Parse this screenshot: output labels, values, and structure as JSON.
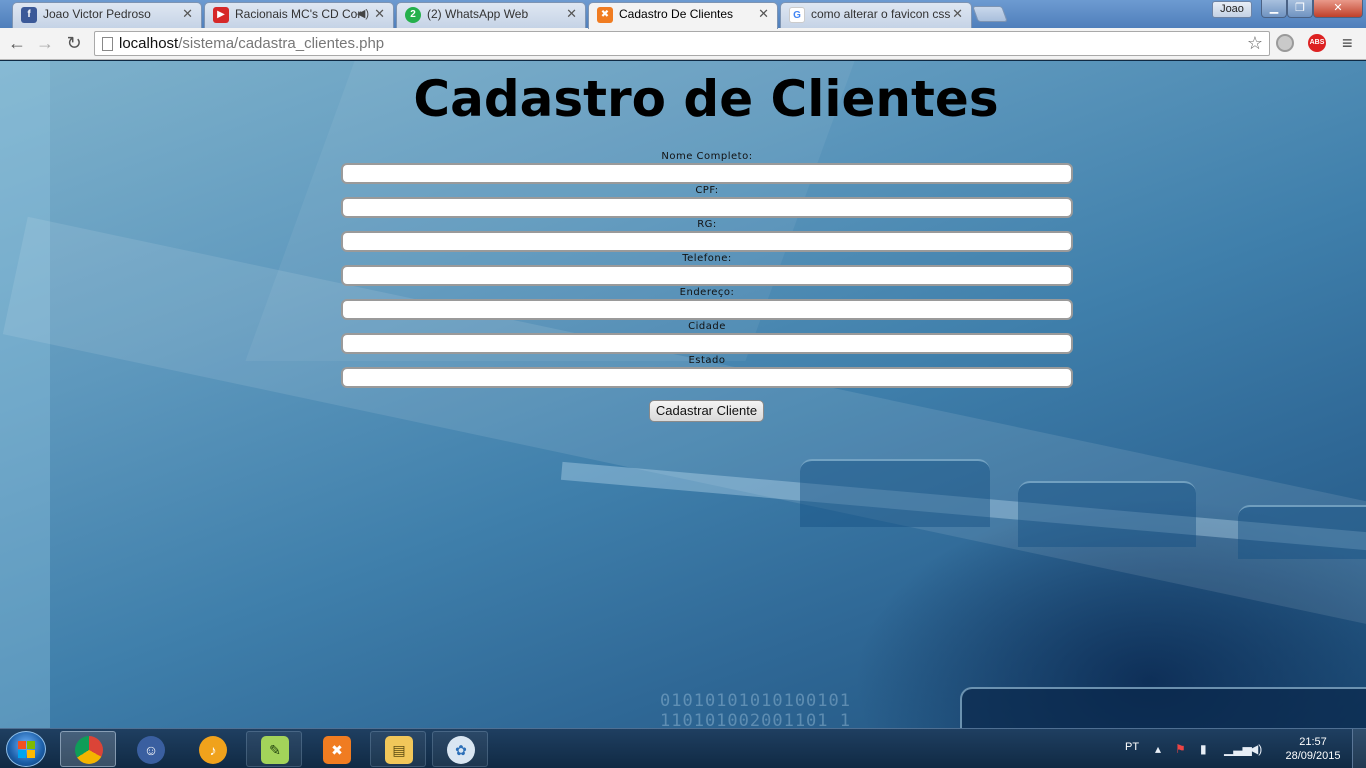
{
  "browser": {
    "tabs": [
      {
        "title": "Joao Victor Pedroso",
        "favicon": "facebook-icon",
        "color": "#3b5998",
        "active": false
      },
      {
        "title": "Racionais MC's CD Cor",
        "favicon": "youtube-icon",
        "color": "#d62828",
        "active": false,
        "audio": true
      },
      {
        "title": "(2) WhatsApp Web",
        "favicon": "whatsapp-icon",
        "badge": "2",
        "color": "#25b04c",
        "active": false
      },
      {
        "title": "Cadastro De Clientes",
        "favicon": "xampp-icon",
        "color": "#f07c21",
        "active": true
      },
      {
        "title": "como alterar o favicon css",
        "favicon": "google-icon",
        "color": "#4285f4",
        "active": false
      }
    ],
    "profile_name": "Joao",
    "url_host": "localhost",
    "url_path": "/sistema/cadastra_clientes.php",
    "extensions": [
      "opera-ext-icon",
      "adblock-icon"
    ],
    "adblock_label": "ABS"
  },
  "page": {
    "title": "Cadastro de Clientes",
    "fields": [
      {
        "label": "Nome Completo:",
        "value": ""
      },
      {
        "label": "CPF:",
        "value": ""
      },
      {
        "label": "RG:",
        "value": ""
      },
      {
        "label": "Telefone:",
        "value": ""
      },
      {
        "label": "Endereço:",
        "value": ""
      },
      {
        "label": "Cidade",
        "value": ""
      },
      {
        "label": "Estado",
        "value": ""
      }
    ],
    "submit_label": "Cadastrar Cliente",
    "background_text_line1": "01010101010100101",
    "background_text_line2": "110101002001101 1"
  },
  "taskbar": {
    "items": [
      {
        "name": "chrome",
        "icon": "chrome-icon",
        "pinned": true
      },
      {
        "name": "avatar-app",
        "icon": "character-icon"
      },
      {
        "name": "fl-studio",
        "icon": "fruity-loops-icon"
      },
      {
        "name": "notepad-plus",
        "icon": "notepad-plus-icon"
      },
      {
        "name": "xampp",
        "icon": "xampp-icon"
      },
      {
        "name": "explorer",
        "icon": "folder-icon"
      },
      {
        "name": "paint",
        "icon": "palette-icon"
      }
    ],
    "language": "PT",
    "time": "21:57",
    "date": "28/09/2015"
  }
}
